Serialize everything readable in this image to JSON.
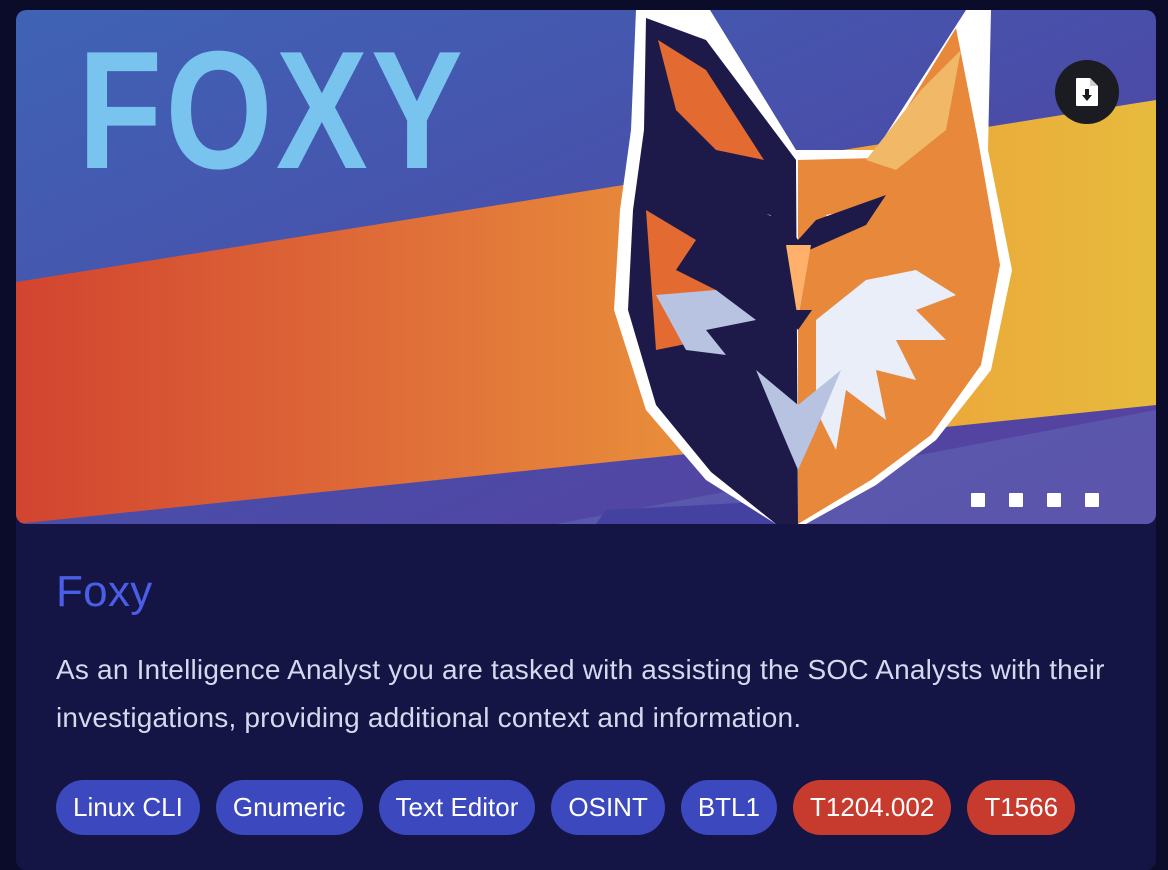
{
  "banner": {
    "logo_text": "FOXY",
    "download_button_label": "Download",
    "carousel": {
      "slides": 4
    }
  },
  "room": {
    "title": "Foxy",
    "description": "As an Intelligence Analyst you are tasked with assisting the SOC Analysts with their investigations, providing additional context and information."
  },
  "tags": [
    {
      "label": "Linux CLI",
      "type": "tool"
    },
    {
      "label": "Gnumeric",
      "type": "tool"
    },
    {
      "label": "Text Editor",
      "type": "tool"
    },
    {
      "label": "OSINT",
      "type": "tool"
    },
    {
      "label": "BTL1",
      "type": "tool"
    },
    {
      "label": "T1204.002",
      "type": "technique"
    },
    {
      "label": "T1566",
      "type": "technique"
    }
  ],
  "colors": {
    "background": "#0b0c2a",
    "card": "#141545",
    "title": "#4a5ee6",
    "tag_blue": "#3c48bd",
    "tag_red": "#c63b2e",
    "logo_text": "#79c3ef"
  },
  "icons": {
    "download": "file-download-icon",
    "mascot": "fox-mascot-icon"
  }
}
